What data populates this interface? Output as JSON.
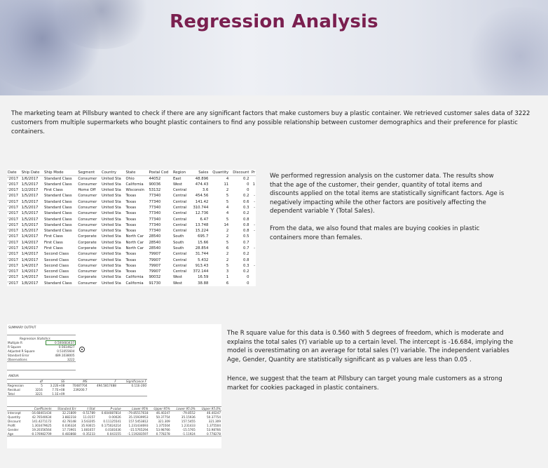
{
  "title": "Regression Analysis",
  "intro": "The marketing team at Pillsbury wanted to check if there are any significant factors that make customers buy a plastic container. We retrieved customer sales data of 3222 customers from multiple supermarkets who bought plastic containers to find any possible relationship between customer demographics and their preference for plastic containers.",
  "table": {
    "headers": [
      "Date",
      "Ship Date",
      "Ship Mode",
      "Segment",
      "Country",
      "State",
      "Postal Cod",
      "Region",
      "Sales",
      "Quantity",
      "Discount",
      "Pr"
    ],
    "rows": [
      [
        "'2017",
        "1/6/2017",
        "Standard Class",
        "Consumer",
        "United Sta",
        "Ohio",
        "44052",
        "East",
        "48.896",
        "4",
        "0.2",
        ""
      ],
      [
        "'2017",
        "1/5/2017",
        "Standard Class",
        "Consumer",
        "United Sta",
        "California",
        "90036",
        "West",
        "474.43",
        "11",
        "0",
        "1"
      ],
      [
        "'2017",
        "1/2/2017",
        "First Class",
        "Home Off",
        "United Sta",
        "Wisconsin",
        "53132",
        "Central",
        "3.6",
        "2",
        "0",
        ""
      ],
      [
        "'2017",
        "1/5/2017",
        "Standard Class",
        "Consumer",
        "United Sta",
        "Texas",
        "77340",
        "Central",
        "454.56",
        "5",
        "0.2",
        "-"
      ],
      [
        "'2017",
        "1/5/2017",
        "Standard Class",
        "Consumer",
        "United Sta",
        "Texas",
        "77340",
        "Central",
        "141.42",
        "5",
        "0.6",
        "-"
      ],
      [
        "'2017",
        "1/5/2017",
        "Standard Class",
        "Consumer",
        "United Sta",
        "Texas",
        "77340",
        "Central",
        "310.744",
        "4",
        "0.3",
        "-"
      ],
      [
        "'2017",
        "1/5/2017",
        "Standard Class",
        "Consumer",
        "United Sta",
        "Texas",
        "77340",
        "Central",
        "12.736",
        "4",
        "0.2",
        ""
      ],
      [
        "'2017",
        "1/5/2017",
        "Standard Class",
        "Consumer",
        "United Sta",
        "Texas",
        "77340",
        "Central",
        "6.47",
        "5",
        "0.8",
        ""
      ],
      [
        "'2017",
        "1/5/2017",
        "Standard Class",
        "Consumer",
        "United Sta",
        "Texas",
        "77340",
        "Central",
        "13.748",
        "14",
        "0.8",
        "-"
      ],
      [
        "'2017",
        "1/5/2017",
        "Standard Class",
        "Consumer",
        "United Sta",
        "Texas",
        "77340",
        "Central",
        "15.224",
        "2",
        "0.8",
        "-"
      ],
      [
        "'2017",
        "1/4/2017",
        "First Class",
        "Corporate",
        "United Sta",
        "North Car",
        "28540",
        "South",
        "695.7",
        "2",
        "0.5",
        ""
      ],
      [
        "'2017",
        "1/4/2017",
        "First Class",
        "Corporate",
        "United Sta",
        "North Car",
        "28540",
        "South",
        "15.66",
        "5",
        "0.7",
        ""
      ],
      [
        "'2017",
        "1/4/2017",
        "First Class",
        "Corporate",
        "United Sta",
        "North Car",
        "28540",
        "South",
        "28.854",
        "6",
        "0.7",
        "-"
      ],
      [
        "'2017",
        "1/4/2017",
        "Second Class",
        "Consumer",
        "United Sta",
        "Texas",
        "79907",
        "Central",
        "31.744",
        "2",
        "0.2",
        ""
      ],
      [
        "'2017",
        "1/4/2017",
        "Second Class",
        "Consumer",
        "United Sta",
        "Texas",
        "79907",
        "Central",
        "5.432",
        "2",
        "0.8",
        ""
      ],
      [
        "'2017",
        "1/4/2017",
        "Second Class",
        "Consumer",
        "United Sta",
        "Texas",
        "79907",
        "Central",
        "913.43",
        "5",
        "0.3",
        "-"
      ],
      [
        "'2017",
        "1/4/2017",
        "Second Class",
        "Consumer",
        "United Sta",
        "Texas",
        "79907",
        "Central",
        "372.144",
        "3",
        "0.2",
        ""
      ],
      [
        "'2017",
        "1/4/2017",
        "Second Class",
        "Corporate",
        "United Sta",
        "California",
        "90032",
        "West",
        "16.59",
        "1",
        "0",
        ""
      ],
      [
        "'2017",
        "1/8/2017",
        "Standard Class",
        "Consumer",
        "United Sta",
        "California",
        "91730",
        "West",
        "38.88",
        "6",
        "0",
        ""
      ]
    ]
  },
  "para1": "We performed regression analysis on the customer data. The results show that the age of the customer, their gender, quantity of total items and discounts applied on the total items are statistically significant factors. Age is negatively impacting while the other factors are positively affecting the dependent variable Y (Total Sales).",
  "para2": "From the data, we also found that males are buying cookies in plastic containers more than females.",
  "para3": "The R square value for this data is 0.560 with 5 degrees of freedom, which is moderate and explains the total sales (Y) variable up to a certain level. The intercept is -16.684, implying the model is overestimating on an average for total sales (Y) variable. The independent variables Age, Gender, Quantity are statistically significant as p values are less than 0.05 .",
  "para4": "Hence, we suggest that the team at Pillsbury can target young male customers as a strong market for cookies packaged in plastic containers.",
  "summary": {
    "heading": "SUMMARY OUTPUT",
    "regstats_title": "Regression Statistics",
    "regstats": [
      [
        "Multiple R",
        "0.500483437"
      ],
      [
        "R Square",
        "0.5614627"
      ],
      [
        "Adjusted R Square",
        "0.51055604"
      ],
      [
        "Standard Error",
        "489.1038005"
      ],
      [
        "Observations",
        "3222"
      ]
    ],
    "anova_title": "ANOVA",
    "anova_headers": [
      "",
      "df",
      "SS",
      "MS",
      "F",
      "Significance F"
    ],
    "anova_rows": [
      [
        "Regression",
        "5",
        "3.22E+08",
        "70487704",
        "494.5817488",
        "0.11E-200"
      ],
      [
        "Residual",
        "3216",
        "7.7E+08",
        "239200.7",
        "",
        ""
      ],
      [
        "Total",
        "3221",
        "1.1E+09",
        "",
        "",
        ""
      ]
    ],
    "coef_headers": [
      "",
      "Coefficients",
      "Standard Err",
      "t Stat",
      "P-value",
      "Lower 95%",
      "Upper 95%",
      "Lower 95.0%",
      "Upper 95.0%"
    ],
    "coef_rows": [
      [
        "Intercept",
        "-16.68401434",
        "32.21809",
        "-0.51789",
        "0.604087814",
        "-79.85517618",
        "46.40247",
        "-79.8552",
        "46.40247"
      ],
      [
        "Quantity",
        "42.76540634",
        "3.882218",
        "11.0157",
        "0.00026",
        "35.15939953",
        "50.37754",
        "35.15936",
        "50.37754"
      ],
      [
        "Discount",
        "141.4271172",
        "42.78148",
        "3.543205",
        "0.11125541",
        "157.5453812",
        "321.309",
        "157.5455",
        "321.309"
      ],
      [
        "Profit",
        "1.303479625",
        "0.036324",
        "35.93615",
        "0.175024214",
        "1.231434693",
        "1.375504",
        "1.231433",
        "1.375504"
      ],
      [
        "Gender",
        "19.20356564",
        "17.73901",
        "1.081657",
        "0.0181636",
        "-15.5765294",
        "53.98766",
        "-15.5765",
        "53.98766"
      ],
      [
        "Age",
        "-0.176982709",
        "0.483868",
        "-0.35233",
        "0.043155",
        "-1.119283597",
        "0.778278",
        "-1.11924",
        "0.778278"
      ]
    ]
  }
}
